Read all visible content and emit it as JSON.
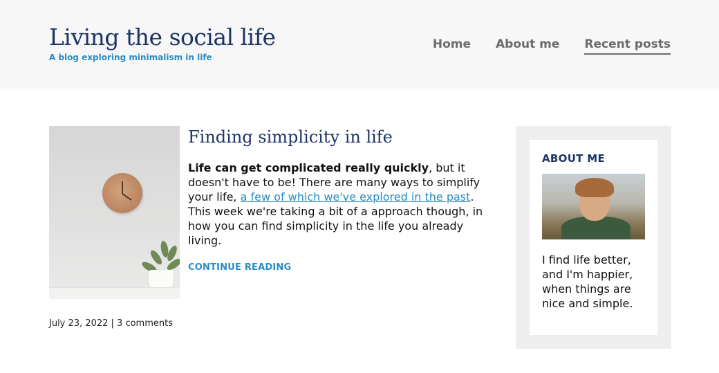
{
  "header": {
    "title": "Living the social life",
    "tagline": "A blog exploring minimalism in life"
  },
  "nav": {
    "items": [
      {
        "label": "Home"
      },
      {
        "label": "About me"
      },
      {
        "label": "Recent posts",
        "active": true
      }
    ]
  },
  "post": {
    "title": "Finding simplicity in life",
    "excerpt_bold": "Life can get complicated really quickly",
    "excerpt_part1": ", but it doesn't have to be! There are many ways to simplify your life, ",
    "excerpt_link": "a few of which we've explored in the past",
    "excerpt_part2": ". This week we're taking a bit of a approach though, in how you can find simplicity in the life you already living.",
    "continue_label": "Continue reading",
    "meta": "July 23, 2022 | 3 comments"
  },
  "sidebar": {
    "heading": "ABOUT ME",
    "text": "I find life better, and I'm happier, when things are nice and simple."
  },
  "colors": {
    "brand": "#1c3466",
    "accent": "#2b8cc4",
    "nav": "#6b6b6b",
    "header_bg": "#f7f7f7",
    "sidebar_bg": "#eeeeee"
  }
}
